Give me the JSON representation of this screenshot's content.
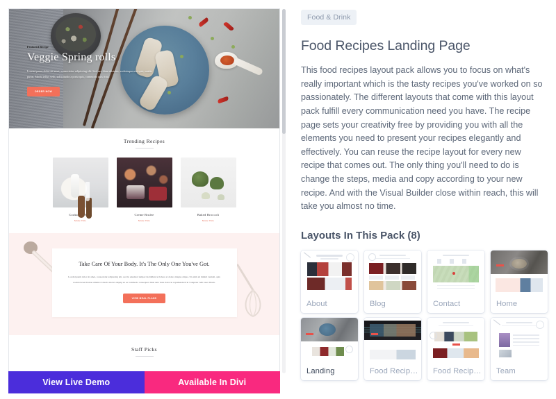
{
  "preview": {
    "hero": {
      "eyebrow": "Featured Recipe",
      "title": "Veggie Spring rolls",
      "body": "Lorem ipsum dolor sit amet, consectetur adipiscing elit. Sed nec diam ultricies, scelerisque nisi quis, mattis purus. Morbi tellus velit, sollicitudin a porta quis, commodo quis risus.",
      "button": "ORDER NOW"
    },
    "trending": {
      "heading": "Trending Recipes",
      "cards": [
        {
          "title": "Cookies & Milk",
          "link": "Make This"
        },
        {
          "title": "Creme Brulee",
          "link": "Make This"
        },
        {
          "title": "Baked Broccoli",
          "link": "Make This"
        }
      ]
    },
    "body_section": {
      "title": "Take Care Of Your Body. It's The Only One You've Got.",
      "copy": "Lorem ipsum dolor sit amet, consectetur adipiscing elit, sed do eiusmod tempor incididunt ut labore et dolore magna aliqua. Ut enim ad minim veniam, quis nostrud exercitation ullamco laboris nisi ut aliquip ex ea commodo consequat. Duis aute irure dolor in reprehenderit in voluptate velit esse cillum.",
      "button": "VIEW MEAL PLANS"
    },
    "staff": {
      "heading": "Staff Picks"
    }
  },
  "cta": {
    "demo_label": "View Live Demo",
    "divi_label": "Available In Divi",
    "demo_color": "#4b2ddb",
    "divi_color": "#f9297f"
  },
  "detail": {
    "category_badge": "Food & Drink",
    "title": "Food Recipes Landing Page",
    "description": "This food recipes layout pack allows you to focus on what's really important which is the tasty recipes you've worked on so passionately. The different layouts that come with this layout pack fulfill every communication need you have. The recipe page sets your creativity free by providing you with all the elements you need to present your recipes elegantly and effectively. You can reuse the recipe layout for every new recipe that comes out. The only thing you'll need to do is change the steps, media and copy according to your new recipe. And with the Visual Builder close within reach, this will take you almost no time.",
    "pack_heading": "Layouts In This Pack (8)",
    "layouts": [
      {
        "label": "About",
        "active": false
      },
      {
        "label": "Blog",
        "active": false
      },
      {
        "label": "Contact",
        "active": false
      },
      {
        "label": "Home",
        "active": false
      },
      {
        "label": "Landing",
        "active": true
      },
      {
        "label": "Food Recip…",
        "active": false
      },
      {
        "label": "Food Recip…",
        "active": false
      },
      {
        "label": "Team",
        "active": false
      }
    ]
  },
  "colors": {
    "badge_bg": "#edf1f6",
    "badge_text": "#8d99ac",
    "heading": "#4a5568",
    "body_text": "#5c6778",
    "label_muted": "#9aa6ba",
    "label_active": "#3f4a5c",
    "accent_coral": "#f3705a"
  }
}
